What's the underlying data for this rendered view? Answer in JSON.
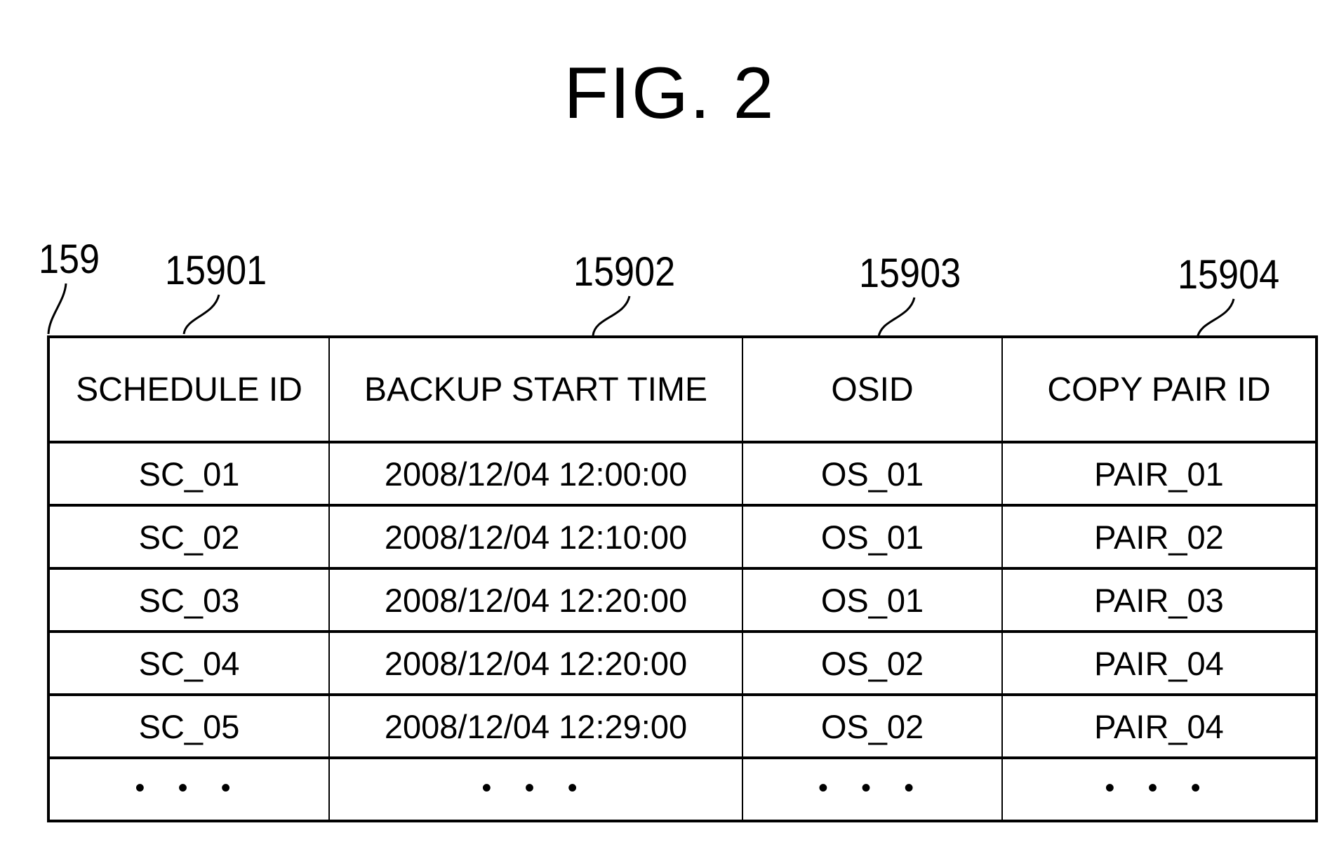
{
  "figure": {
    "title": "FIG. 2",
    "reference_labels": {
      "table": "159",
      "col_schedule_id": "15901",
      "col_backup_start_time": "15902",
      "col_osid": "15903",
      "col_copy_pair_id": "15904"
    }
  },
  "table": {
    "headers": [
      "SCHEDULE ID",
      "BACKUP START TIME",
      "OSID",
      "COPY PAIR ID"
    ],
    "rows": [
      [
        "SC_01",
        "2008/12/04 12:00:00",
        "OS_01",
        "PAIR_01"
      ],
      [
        "SC_02",
        "2008/12/04 12:10:00",
        "OS_01",
        "PAIR_02"
      ],
      [
        "SC_03",
        "2008/12/04 12:20:00",
        "OS_01",
        "PAIR_03"
      ],
      [
        "SC_04",
        "2008/12/04 12:20:00",
        "OS_02",
        "PAIR_04"
      ],
      [
        "SC_05",
        "2008/12/04 12:29:00",
        "OS_02",
        "PAIR_04"
      ],
      [
        "• • •",
        "• • •",
        "• • •",
        "• • •"
      ]
    ]
  }
}
